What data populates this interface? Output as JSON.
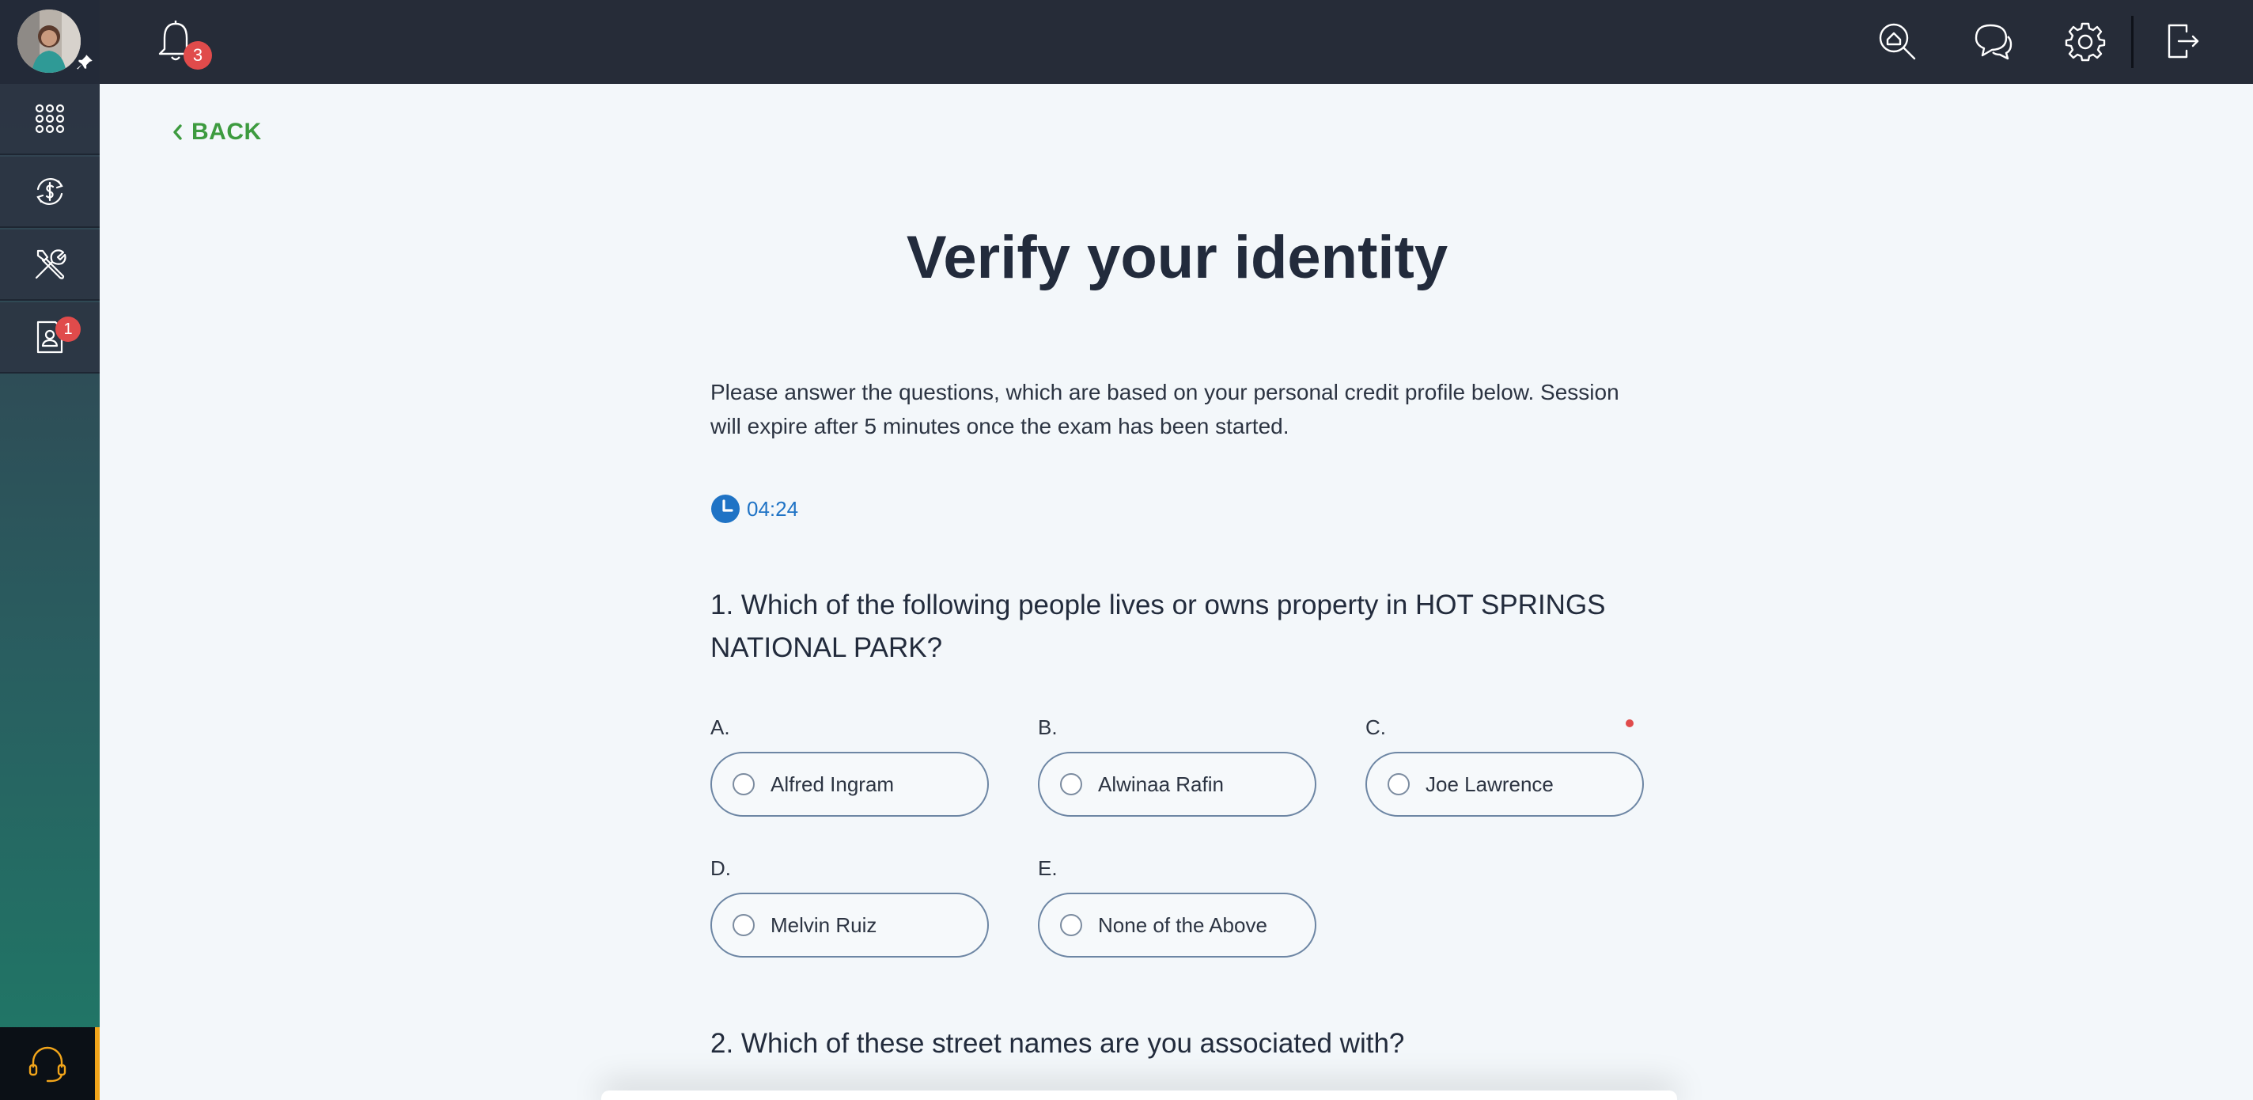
{
  "topbar": {
    "notification_count": "3",
    "icons": [
      "bell-icon",
      "search-icon",
      "chat-icon",
      "gear-icon",
      "logout-icon"
    ]
  },
  "sidebar": {
    "items": [
      {
        "name": "apps",
        "icon": "grid-icon"
      },
      {
        "name": "payments",
        "icon": "dollar-refresh-icon"
      },
      {
        "name": "tools",
        "icon": "tools-icon"
      },
      {
        "name": "contacts",
        "icon": "contact-card-icon",
        "badge": "1"
      }
    ],
    "support_icon": "headset-icon"
  },
  "main": {
    "back_label": "BACK",
    "title": "Verify your identity",
    "intro": "Please answer the questions, which are based on your personal credit profile below. Session will expire after 5 minutes once the exam has been started.",
    "timer": "04:24",
    "questions": [
      {
        "text": "1. Which of the following people lives or owns property in HOT SPRINGS NATIONAL PARK?",
        "options": [
          {
            "letter": "A.",
            "label": "Alfred Ingram"
          },
          {
            "letter": "B.",
            "label": "Alwinaa Rafin"
          },
          {
            "letter": "C.",
            "label": "Joe Lawrence"
          },
          {
            "letter": "D.",
            "label": "Melvin Ruiz"
          },
          {
            "letter": "E.",
            "label": "None of the Above"
          }
        ]
      },
      {
        "text": "2. Which of these street names are you associated with?"
      }
    ]
  },
  "colors": {
    "accent_green": "#3d9b3f",
    "timer_blue": "#1f73c5",
    "badge_red": "#e04b4b",
    "support_accent": "#f2a51a"
  }
}
